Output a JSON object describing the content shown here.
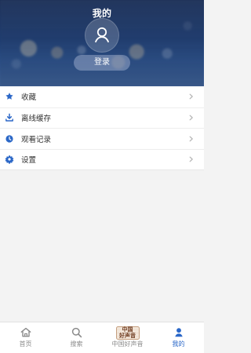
{
  "header": {
    "title": "我的",
    "login_label": "登录"
  },
  "menu": {
    "items": [
      {
        "label": "收藏",
        "icon": "star-icon"
      },
      {
        "label": "离线缓存",
        "icon": "download-icon"
      },
      {
        "label": "观看记录",
        "icon": "history-icon"
      },
      {
        "label": "设置",
        "icon": "gear-icon"
      }
    ]
  },
  "tabbar": {
    "items": [
      {
        "label": "首页",
        "icon": "home-icon"
      },
      {
        "label": "搜索",
        "icon": "search-icon"
      },
      {
        "label": "中国好声音",
        "icon": "voice-logo-icon",
        "logo_lines": [
          "中国",
          "好声音"
        ]
      },
      {
        "label": "我的",
        "icon": "person-icon",
        "active": true
      }
    ]
  },
  "colors": {
    "accent": "#2a67c8",
    "inactive": "#8b8b8b",
    "header_gradient_top": "#1b2f57",
    "header_gradient_bottom": "#3e5f93",
    "menu_icon_blue": "#2b67c7"
  }
}
